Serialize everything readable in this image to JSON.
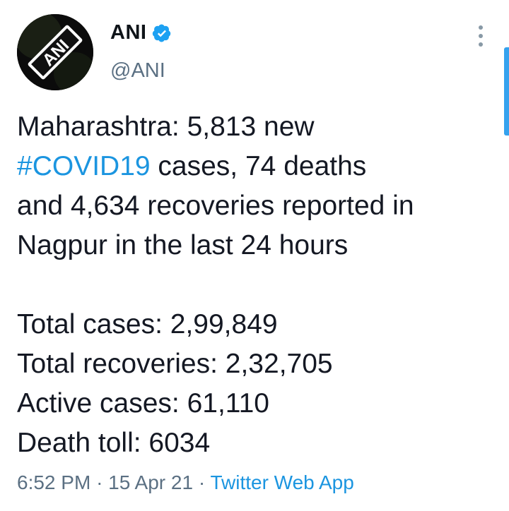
{
  "author": {
    "display_name": "ANI",
    "handle": "@ANI",
    "avatar_text": "ANI",
    "verified": true
  },
  "tweet": {
    "line1": "Maharashtra: 5,813 new",
    "hashtag": "#COVID19",
    "line2_rest": " cases, 74 deaths",
    "line3": "and 4,634 recoveries reported in",
    "line4": "Nagpur in the last 24 hours",
    "stats": [
      "Total cases: 2,99,849",
      "Total recoveries: 2,32,705",
      "Active cases: 61,110",
      "Death toll: 6034"
    ]
  },
  "meta": {
    "time": "6:52 PM",
    "separator": "·",
    "date": "15 Apr 21",
    "source": "Twitter Web App"
  },
  "colors": {
    "link": "#1b95e0",
    "secondary_text": "#5b7083",
    "verified": "#1da1f2",
    "scrollbar": "#35a2ee"
  },
  "icons": {
    "verified": "verified-badge-icon",
    "more": "more-options-icon"
  }
}
